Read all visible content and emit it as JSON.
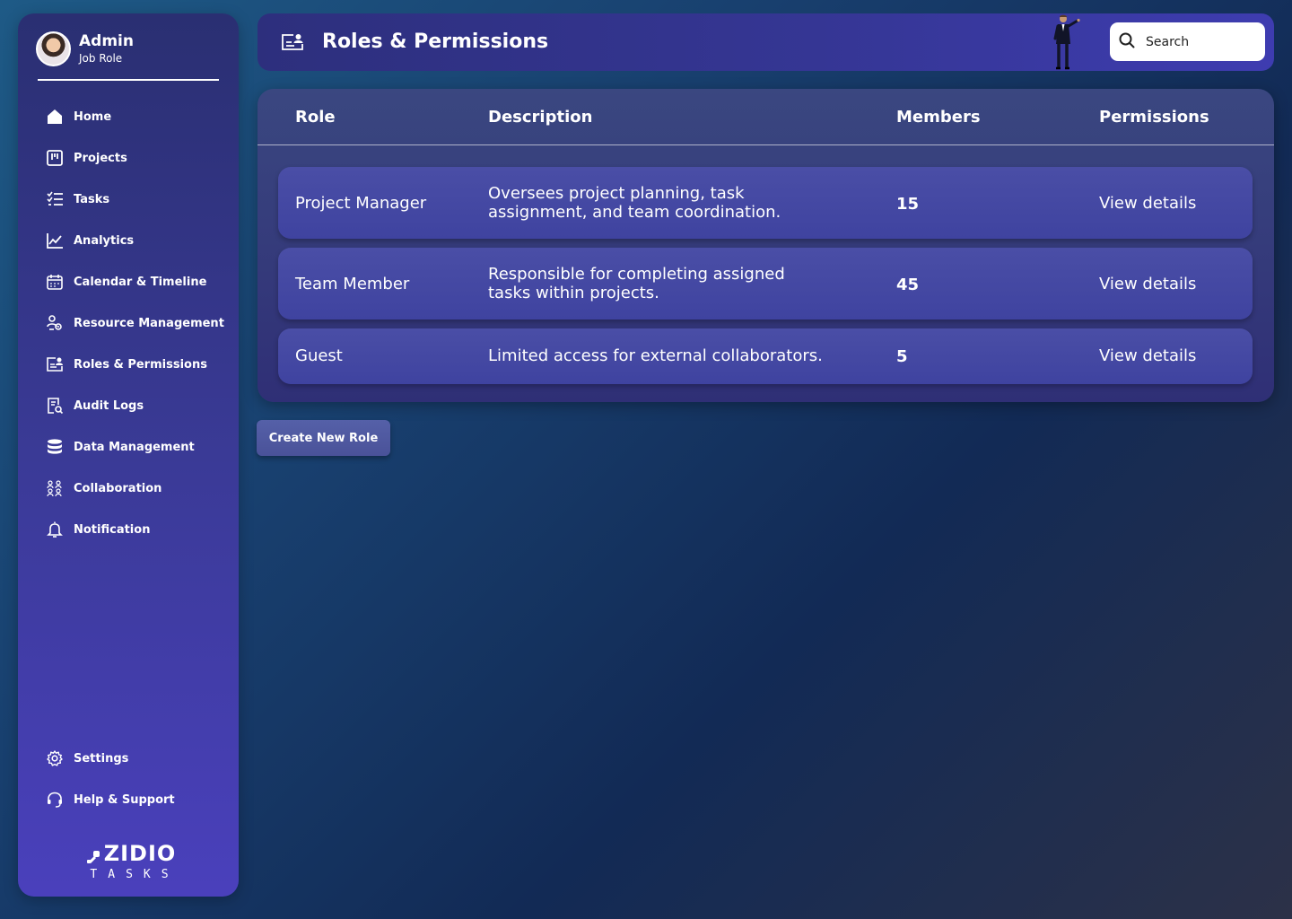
{
  "sidebar": {
    "profile": {
      "name": "Admin",
      "role": "Job Role"
    },
    "items": [
      {
        "label": "Home",
        "icon": "home-icon"
      },
      {
        "label": "Projects",
        "icon": "projects-icon"
      },
      {
        "label": "Tasks",
        "icon": "tasks-icon"
      },
      {
        "label": "Analytics",
        "icon": "analytics-icon"
      },
      {
        "label": "Calendar & Timeline",
        "icon": "calendar-icon"
      },
      {
        "label": "Resource Management",
        "icon": "resource-icon"
      },
      {
        "label": "Roles & Permissions",
        "icon": "roles-icon"
      },
      {
        "label": "Audit Logs",
        "icon": "audit-logs-icon"
      },
      {
        "label": "Data Management",
        "icon": "database-icon"
      },
      {
        "label": "Collaboration",
        "icon": "collaboration-icon"
      },
      {
        "label": "Notification",
        "icon": "bell-icon"
      }
    ],
    "bottom_items": [
      {
        "label": "Settings",
        "icon": "gear-icon"
      },
      {
        "label": "Help & Support",
        "icon": "headset-icon"
      }
    ],
    "logo": {
      "main": "ZIDIO",
      "sub": "TASKS"
    }
  },
  "header": {
    "title": "Roles & Permissions",
    "search_placeholder": "Search"
  },
  "table": {
    "columns": [
      "Role",
      "Description",
      "Members",
      "Permissions"
    ],
    "rows": [
      {
        "role": "Project Manager",
        "description_lines": [
          "Oversees project planning, task",
          "assignment, and team coordination."
        ],
        "members": "15",
        "permissions": "View details"
      },
      {
        "role": "Team Member",
        "description_lines": [
          "Responsible for completing assigned",
          "tasks within projects."
        ],
        "members": "45",
        "permissions": "View details"
      },
      {
        "role": "Guest",
        "description_lines": [
          "Limited access for external collaborators."
        ],
        "members": "5",
        "permissions": "View details"
      }
    ]
  },
  "actions": {
    "create_role": "Create New Role"
  },
  "colors": {
    "sidebar_top": "#2a2f72",
    "sidebar_bottom": "#4a40bc",
    "header": "#353694",
    "row": "#4a4ea6",
    "button": "#5560a8"
  }
}
